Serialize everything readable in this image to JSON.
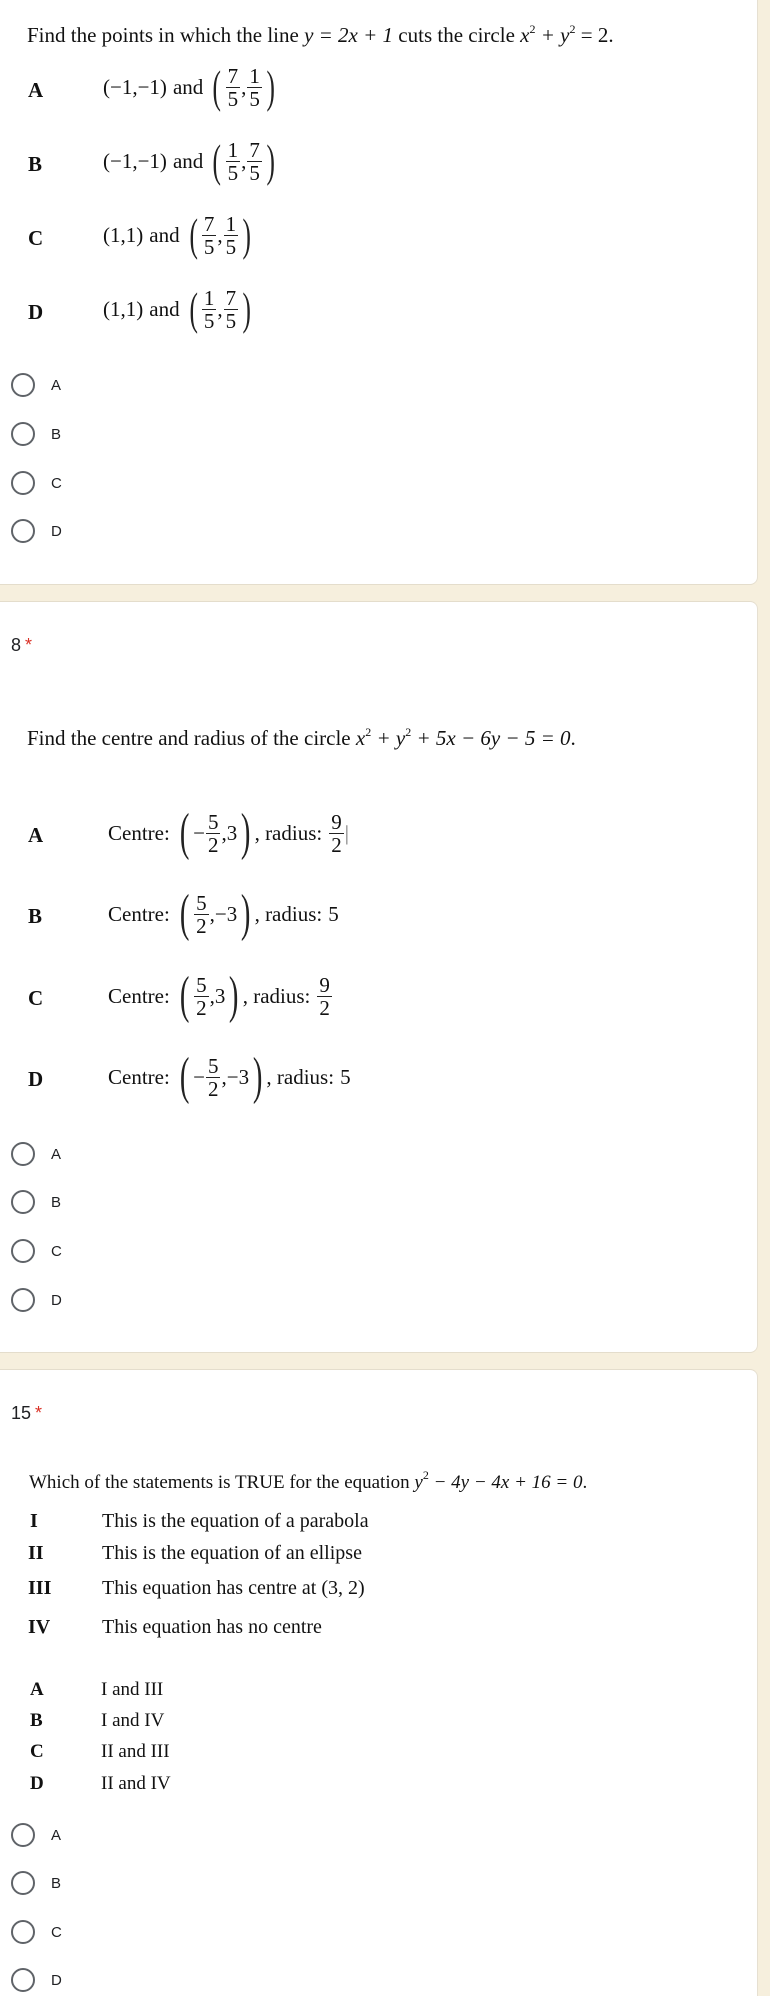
{
  "colors": {
    "background": "#f6efdd",
    "card": "#ffffff",
    "required_asterisk": "#d93025",
    "radio_border": "#5f6368"
  },
  "questions": [
    {
      "number": "",
      "required_marker": "",
      "text_before": "Find the points in which the line ",
      "math1": "y = 2x + 1",
      "text_middle": " cuts the circle ",
      "math2_a": "x",
      "math2_b": " + y",
      "math2_c": " = 2",
      "sup": "2",
      "text_end": ".",
      "options": [
        {
          "label": "A",
          "point": "(−1,−1)",
          "and": "and",
          "frac1": {
            "num": "7",
            "den": "5"
          },
          "frac2": {
            "num": "1",
            "den": "5"
          }
        },
        {
          "label": "B",
          "point": "(−1,−1)",
          "and": "and",
          "frac1": {
            "num": "1",
            "den": "5"
          },
          "frac2": {
            "num": "7",
            "den": "5"
          }
        },
        {
          "label": "C",
          "point": "(1,1)",
          "and": "and",
          "frac1": {
            "num": "7",
            "den": "5"
          },
          "frac2": {
            "num": "1",
            "den": "5"
          }
        },
        {
          "label": "D",
          "point": "(1,1)",
          "and": "and",
          "frac1": {
            "num": "1",
            "den": "5"
          },
          "frac2": {
            "num": "7",
            "den": "5"
          }
        }
      ],
      "radio_options": [
        "A",
        "B",
        "C",
        "D"
      ]
    },
    {
      "number": "8",
      "required_marker": "*",
      "text_before": "Find the centre and radius of the circle ",
      "math": "x² + y² + 5x − 6y − 5 = 0",
      "math_a": "x",
      "math_b": " + y",
      "math_c": " + 5x − 6y − 5 = 0",
      "sup": "2",
      "text_end": ".",
      "centre_label": "Centre:",
      "radius_label": ", radius:",
      "options": [
        {
          "label": "A",
          "sign": "−",
          "frac": {
            "num": "5",
            "den": "2"
          },
          "second": ",3",
          "radius_frac": {
            "num": "9",
            "den": "2"
          },
          "radius": "",
          "cursor": "|"
        },
        {
          "label": "B",
          "sign": "",
          "frac": {
            "num": "5",
            "den": "2"
          },
          "second": ",−3",
          "radius_frac": null,
          "radius": "5"
        },
        {
          "label": "C",
          "sign": "",
          "frac": {
            "num": "5",
            "den": "2"
          },
          "second": ",3",
          "radius_frac": {
            "num": "9",
            "den": "2"
          },
          "radius": ""
        },
        {
          "label": "D",
          "sign": "−",
          "frac": {
            "num": "5",
            "den": "2"
          },
          "second": ",−3",
          "radius_frac": null,
          "radius": "5"
        }
      ],
      "radio_options": [
        "A",
        "B",
        "C",
        "D"
      ]
    },
    {
      "number": "15",
      "required_marker": "*",
      "text_before": "Which of the statements is TRUE for the equation ",
      "math_a": "y",
      "math_b": " − 4y − 4x + 16 = 0",
      "sup": "2",
      "text_end": ".",
      "statements": [
        {
          "label": "I",
          "text": "This is the equation of a parabola"
        },
        {
          "label": "II",
          "text": "This is the equation of an ellipse"
        },
        {
          "label": "III",
          "text": "This equation has centre at (3, 2)"
        },
        {
          "label": "IV",
          "text": "This equation has no centre"
        }
      ],
      "choices": [
        {
          "label": "A",
          "text": "I and III"
        },
        {
          "label": "B",
          "text": "I and IV"
        },
        {
          "label": "C",
          "text": "II and III"
        },
        {
          "label": "D",
          "text": "II and IV"
        }
      ],
      "radio_options": [
        "A",
        "B",
        "C",
        "D"
      ]
    }
  ]
}
